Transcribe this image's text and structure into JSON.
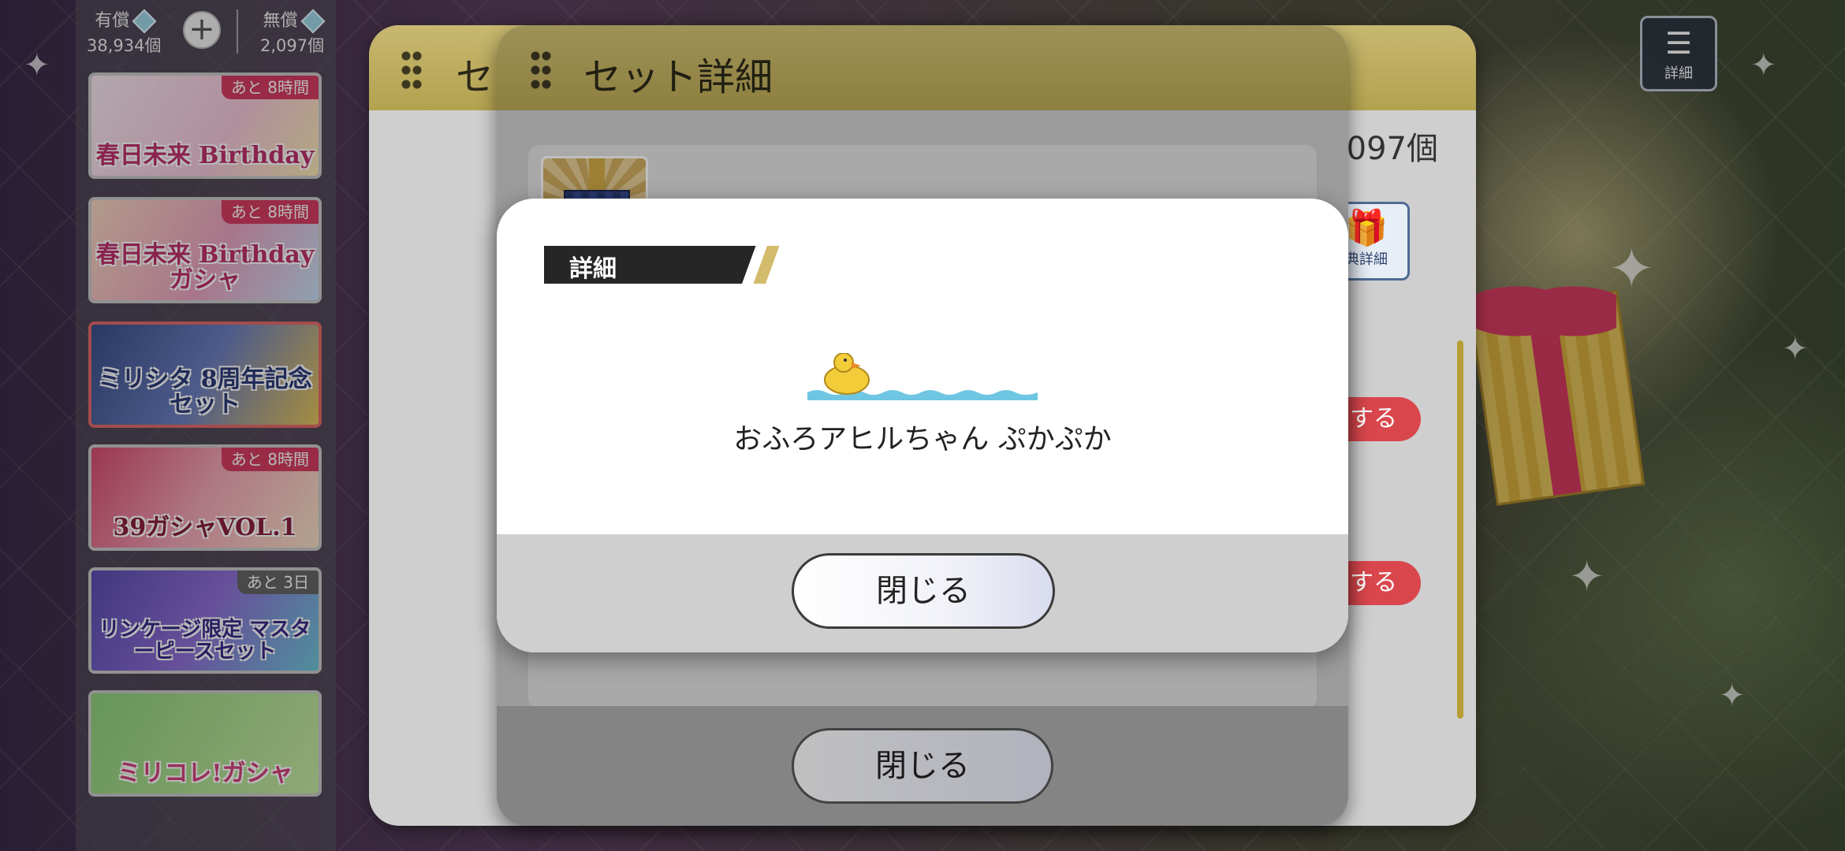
{
  "currency": {
    "paid": {
      "label": "有償",
      "amount": "38,934個"
    },
    "free": {
      "label": "無償",
      "amount": "2,097個"
    }
  },
  "banners": [
    {
      "title": "春日未来 Birthday",
      "timer": "あと 8時間"
    },
    {
      "title": "春日未来 Birthdayガシャ",
      "timer": "あと 8時間"
    },
    {
      "title": "ミリシタ 8周年記念セット",
      "timer": ""
    },
    {
      "title": "39ガシャVOL.1",
      "timer": "あと 8時間"
    },
    {
      "title": "リンケージ限定 マスターピースセット",
      "timer": "あと 3日"
    },
    {
      "title": "ミリコレ!ガシャ",
      "timer": ""
    }
  ],
  "top_right_button": {
    "label": "詳細",
    "icon": "list-search-icon"
  },
  "back_dialog": {
    "title": "セ",
    "balance": "097個",
    "bonus_label": "典詳細",
    "buy_label": "する"
  },
  "set_dialog": {
    "title": "セット詳細",
    "close_label": "閉じる"
  },
  "detail_popup": {
    "tag": "詳細",
    "item_name": "おふろアヒルちゃん ぷかぷか",
    "close_label": "閉じる"
  },
  "colors": {
    "header_gold": "#b6a451",
    "accent_pink": "#d53c62",
    "buy_red": "#d9474d"
  }
}
